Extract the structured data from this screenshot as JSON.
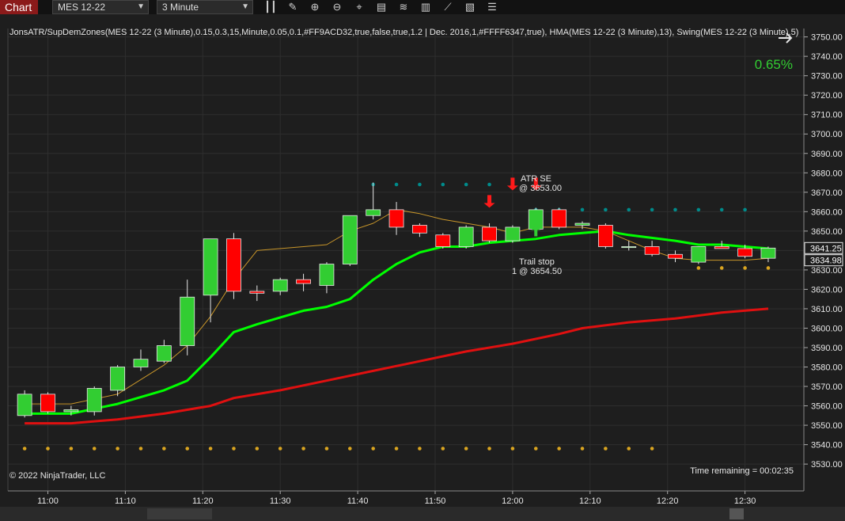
{
  "toolbar": {
    "chart_tab": "Chart",
    "instrument": "MES 12-22",
    "interval": "3 Minute",
    "icons": [
      "bar-type-icon",
      "pencil-icon",
      "zoom-in-icon",
      "zoom-out-icon",
      "crosshair-icon",
      "properties-icon",
      "indicators-icon",
      "strategies-icon",
      "data-box-icon",
      "template-icon"
    ]
  },
  "chart_header": {
    "indicators_text": "JonsATR/SupDemZones(MES 12-22 (3 Minute),0.15,0.3,15,Minute,0.05,0.1,#FF9ACD32,true,false,true,1.2 | Dec. 2016,1,#FFFF6347,true), HMA(MES 12-22 (3 Minute),13), Swing(MES 12-22 (3 Minute),5)",
    "percent_change": "0.65%",
    "copyright": "© 2022 NinjaTrader, LLC",
    "time_remaining": "Time remaining = 00:02:35"
  },
  "annotations": {
    "entry_label_1": "ATR SE",
    "entry_label_2": "@ 3653.00",
    "exit_label_1": "Trail stop",
    "exit_label_2": "1 @ 3654.50"
  },
  "colors": {
    "background": "#1e1e1e",
    "up_candle": "#32cd32",
    "down_candle": "#ff0000",
    "hma": "#00ff00",
    "slow_ma": "#e01010",
    "fast_ma": "#c8962a",
    "swing_high": "#008b8b",
    "swing_low": "#daa520",
    "price_tag": "#1e1e1e"
  },
  "chart_data": {
    "type": "candlestick",
    "instrument": "MES 12-22",
    "interval": "3 Minute",
    "ylim": [
      3525,
      3755
    ],
    "y_ticks": [
      "3530.00",
      "3540.00",
      "3550.00",
      "3560.00",
      "3570.00",
      "3580.00",
      "3590.00",
      "3600.00",
      "3610.00",
      "3620.00",
      "3630.00",
      "3640.00",
      "3650.00",
      "3660.00",
      "3670.00",
      "3680.00",
      "3690.00",
      "3700.00",
      "3710.00",
      "3720.00",
      "3730.00",
      "3740.00",
      "3750.00"
    ],
    "x_ticks": [
      "11:00",
      "11:10",
      "11:20",
      "11:30",
      "11:40",
      "11:50",
      "12:00",
      "12:10",
      "12:20",
      "12:30"
    ],
    "x_tick_minutes": [
      0,
      10,
      20,
      30,
      40,
      50,
      60,
      70,
      80,
      90
    ],
    "current_price_labels": [
      "3641.25",
      "3634.98"
    ],
    "candles": [
      {
        "t": -3,
        "o": 3555,
        "h": 3568,
        "l": 3554,
        "c": 3566
      },
      {
        "t": 0,
        "o": 3566,
        "h": 3567,
        "l": 3556,
        "c": 3557
      },
      {
        "t": 3,
        "o": 3557,
        "h": 3560,
        "l": 3555,
        "c": 3558
      },
      {
        "t": 6,
        "o": 3557,
        "h": 3570,
        "l": 3555,
        "c": 3569
      },
      {
        "t": 9,
        "o": 3568,
        "h": 3581,
        "l": 3565,
        "c": 3580
      },
      {
        "t": 12,
        "o": 3580,
        "h": 3589,
        "l": 3578,
        "c": 3584
      },
      {
        "t": 15,
        "o": 3583,
        "h": 3594,
        "l": 3582,
        "c": 3591
      },
      {
        "t": 18,
        "o": 3591,
        "h": 3625,
        "l": 3586,
        "c": 3616
      },
      {
        "t": 21,
        "o": 3617,
        "h": 3646,
        "l": 3603,
        "c": 3646
      },
      {
        "t": 24,
        "o": 3646,
        "h": 3649,
        "l": 3615,
        "c": 3619
      },
      {
        "t": 27,
        "o": 3619,
        "h": 3622,
        "l": 3614,
        "c": 3618
      },
      {
        "t": 30,
        "o": 3619,
        "h": 3626,
        "l": 3617,
        "c": 3625
      },
      {
        "t": 33,
        "o": 3625,
        "h": 3628,
        "l": 3619,
        "c": 3623
      },
      {
        "t": 36,
        "o": 3622,
        "h": 3634,
        "l": 3618,
        "c": 3633
      },
      {
        "t": 39,
        "o": 3633,
        "h": 3658,
        "l": 3632,
        "c": 3658
      },
      {
        "t": 42,
        "o": 3658,
        "h": 3675,
        "l": 3656,
        "c": 3661
      },
      {
        "t": 45,
        "o": 3661,
        "h": 3665,
        "l": 3648,
        "c": 3652
      },
      {
        "t": 48,
        "o": 3653,
        "h": 3654,
        "l": 3647,
        "c": 3649
      },
      {
        "t": 51,
        "o": 3648,
        "h": 3649,
        "l": 3641,
        "c": 3642
      },
      {
        "t": 54,
        "o": 3642,
        "h": 3653,
        "l": 3641,
        "c": 3652
      },
      {
        "t": 57,
        "o": 3652,
        "h": 3654,
        "l": 3644,
        "c": 3645
      },
      {
        "t": 60,
        "o": 3645,
        "h": 3653,
        "l": 3644,
        "c": 3652
      },
      {
        "t": 63,
        "o": 3651,
        "h": 3662,
        "l": 3650,
        "c": 3661
      },
      {
        "t": 66,
        "o": 3661,
        "h": 3662,
        "l": 3651,
        "c": 3652
      },
      {
        "t": 69,
        "o": 3653,
        "h": 3655,
        "l": 3651,
        "c": 3654
      },
      {
        "t": 72,
        "o": 3653,
        "h": 3654,
        "l": 3641,
        "c": 3642
      },
      {
        "t": 75,
        "o": 3642,
        "h": 3645,
        "l": 3640,
        "c": 3642
      },
      {
        "t": 78,
        "o": 3642,
        "h": 3645,
        "l": 3637,
        "c": 3638
      },
      {
        "t": 81,
        "o": 3638,
        "h": 3640,
        "l": 3634,
        "c": 3636
      },
      {
        "t": 84,
        "o": 3634,
        "h": 3642,
        "l": 3633,
        "c": 3642
      },
      {
        "t": 87,
        "o": 3642,
        "h": 3645,
        "l": 3641,
        "c": 3641
      },
      {
        "t": 90,
        "o": 3641,
        "h": 3643,
        "l": 3636,
        "c": 3637
      },
      {
        "t": 93,
        "o": 3636,
        "h": 3642,
        "l": 3634,
        "c": 3641.25
      }
    ],
    "series": [
      {
        "color": "#00ff00",
        "width": 3,
        "points": [
          [
            -3,
            3556
          ],
          [
            3,
            3556
          ],
          [
            9,
            3561
          ],
          [
            15,
            3568
          ],
          [
            18,
            3573
          ],
          [
            21,
            3585
          ],
          [
            24,
            3598
          ],
          [
            27,
            3602
          ],
          [
            33,
            3609
          ],
          [
            36,
            3611
          ],
          [
            39,
            3615
          ],
          [
            42,
            3625
          ],
          [
            45,
            3633
          ],
          [
            48,
            3639
          ],
          [
            51,
            3642
          ],
          [
            54,
            3642
          ],
          [
            57,
            3644
          ],
          [
            60,
            3645
          ],
          [
            63,
            3646
          ],
          [
            66,
            3648
          ],
          [
            72,
            3650
          ],
          [
            75,
            3648
          ],
          [
            81,
            3645
          ],
          [
            84,
            3643
          ],
          [
            87,
            3643
          ],
          [
            90,
            3642
          ],
          [
            93,
            3641
          ]
        ]
      },
      {
        "color": "#e01010",
        "width": 3,
        "points": [
          [
            -3,
            3551
          ],
          [
            3,
            3551
          ],
          [
            9,
            3553
          ],
          [
            15,
            3556
          ],
          [
            21,
            3560
          ],
          [
            24,
            3564
          ],
          [
            30,
            3568
          ],
          [
            36,
            3573
          ],
          [
            42,
            3578
          ],
          [
            48,
            3583
          ],
          [
            54,
            3588
          ],
          [
            60,
            3592
          ],
          [
            66,
            3597
          ],
          [
            69,
            3600
          ],
          [
            75,
            3603
          ],
          [
            81,
            3605
          ],
          [
            87,
            3608
          ],
          [
            93,
            3610
          ]
        ]
      },
      {
        "color": "#c8962a",
        "width": 1,
        "points": [
          [
            -3,
            3561
          ],
          [
            3,
            3561
          ],
          [
            9,
            3566
          ],
          [
            15,
            3581
          ],
          [
            18,
            3591
          ],
          [
            21,
            3606
          ],
          [
            24,
            3625
          ],
          [
            27,
            3640
          ],
          [
            33,
            3642
          ],
          [
            36,
            3643
          ],
          [
            39,
            3650
          ],
          [
            42,
            3654
          ],
          [
            45,
            3661
          ],
          [
            48,
            3659
          ],
          [
            51,
            3656
          ],
          [
            54,
            3654
          ],
          [
            57,
            3652
          ],
          [
            60,
            3649
          ],
          [
            63,
            3652
          ],
          [
            66,
            3652
          ],
          [
            69,
            3652
          ],
          [
            72,
            3650
          ],
          [
            75,
            3645
          ],
          [
            78,
            3640
          ],
          [
            81,
            3636
          ],
          [
            84,
            3635
          ],
          [
            87,
            3635
          ],
          [
            90,
            3635
          ],
          [
            93,
            3636
          ]
        ]
      }
    ],
    "swing_high_dots": {
      "value": 3674,
      "from": 42,
      "to": 57
    },
    "swing_high_dots_2": {
      "value": 3661,
      "from": 63,
      "to": 90
    },
    "swing_low_dots": {
      "value": 3538,
      "from": -3,
      "to": 78
    },
    "swing_low_dots_2": {
      "value": 3631,
      "from": 84,
      "to": 93
    },
    "entry_arrows": [
      {
        "t": 57,
        "price": 3662
      },
      {
        "t": 60,
        "price": 3671
      },
      {
        "t": 63,
        "price": 3671
      }
    ],
    "exit_arrows": [
      {
        "t": 63,
        "price": 3653
      }
    ]
  }
}
